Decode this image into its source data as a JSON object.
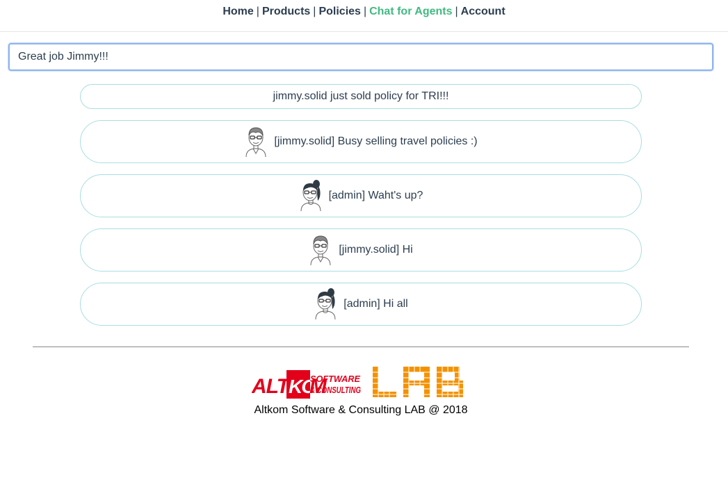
{
  "nav": {
    "home": "Home",
    "products": "Products",
    "policies": "Policies",
    "chat": "Chat for Agents",
    "account": "Account",
    "separator": "|",
    "active_color": "#42b983"
  },
  "chat": {
    "input_value": "Great job Jimmy!!!",
    "notice": "jimmy.solid just sold policy for TRI!!!",
    "messages": [
      {
        "user": "jimmy.solid",
        "avatar": "male-agent-icon",
        "text": "[jimmy.solid] Busy selling travel policies :)"
      },
      {
        "user": "admin",
        "avatar": "female-agent-icon",
        "text": "[admin] Waht's up?"
      },
      {
        "user": "jimmy.solid",
        "avatar": "male-agent-icon",
        "text": "[jimmy.solid] Hi"
      },
      {
        "user": "admin",
        "avatar": "female-agent-icon",
        "text": "[admin] Hi all"
      }
    ]
  },
  "footer": {
    "logo_alt": "ALTKOM SOFTWARE & CONSULTING LAB",
    "text": "Altkom Software & Consulting LAB @ 2018",
    "brand_red": "#e3001b",
    "brand_orange": "#f39200"
  }
}
